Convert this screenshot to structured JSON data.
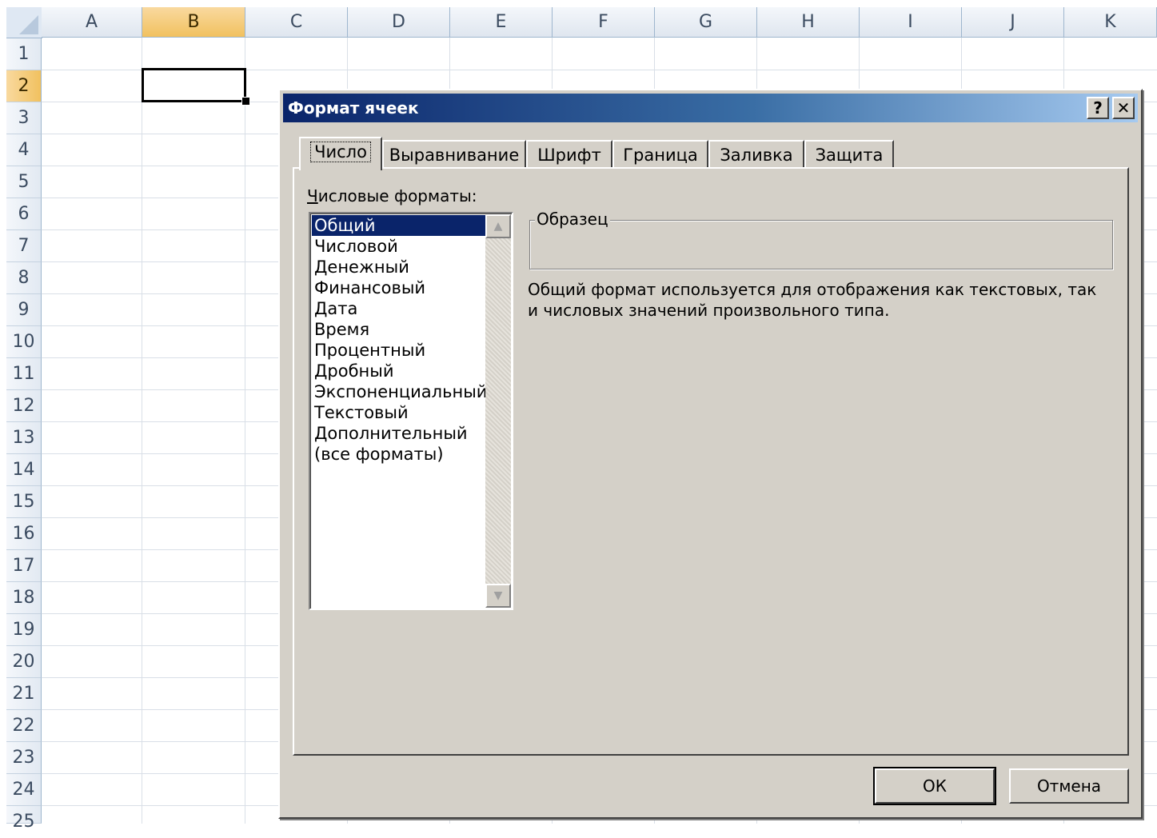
{
  "spreadsheet": {
    "columns": [
      "A",
      "B",
      "C",
      "D",
      "E",
      "F",
      "G",
      "H",
      "I",
      "J",
      "K"
    ],
    "active_column": "B",
    "rows": [
      "1",
      "2",
      "3",
      "4",
      "5",
      "6",
      "7",
      "8",
      "9",
      "10",
      "11",
      "12",
      "13",
      "14",
      "15",
      "16",
      "17",
      "18",
      "19",
      "20",
      "21",
      "22",
      "23",
      "24",
      "25"
    ],
    "active_row": "2"
  },
  "dialog": {
    "title": "Формат ячеек",
    "help_label": "?",
    "close_label": "✕",
    "tabs": [
      "Число",
      "Выравнивание",
      "Шрифт",
      "Граница",
      "Заливка",
      "Защита"
    ],
    "active_tab": "Число",
    "formats_label_mnemonic": "Ч",
    "formats_label_rest": "исловые форматы:",
    "format_list": [
      "Общий",
      "Числовой",
      "Денежный",
      "Финансовый",
      "Дата",
      "Время",
      "Процентный",
      "Дробный",
      "Экспоненциальный",
      "Текстовый",
      "Дополнительный",
      "(все форматы)"
    ],
    "selected_format": "Общий",
    "sample_label": "Образец",
    "description": "Общий формат используется для отображения как текстовых, так и числовых значений произвольного типа.",
    "ok_label": "ОК",
    "cancel_label": "Отмена"
  },
  "icons": {
    "scroll_up": "triangle-up-icon",
    "scroll_down": "triangle-down-icon"
  },
  "colors": {
    "title_bar_start": "#0a246a",
    "title_bar_end": "#a6caf0",
    "selection": "#0a246a",
    "active_header": "#f1c15f",
    "dialog_face": "#d4d0c8"
  }
}
